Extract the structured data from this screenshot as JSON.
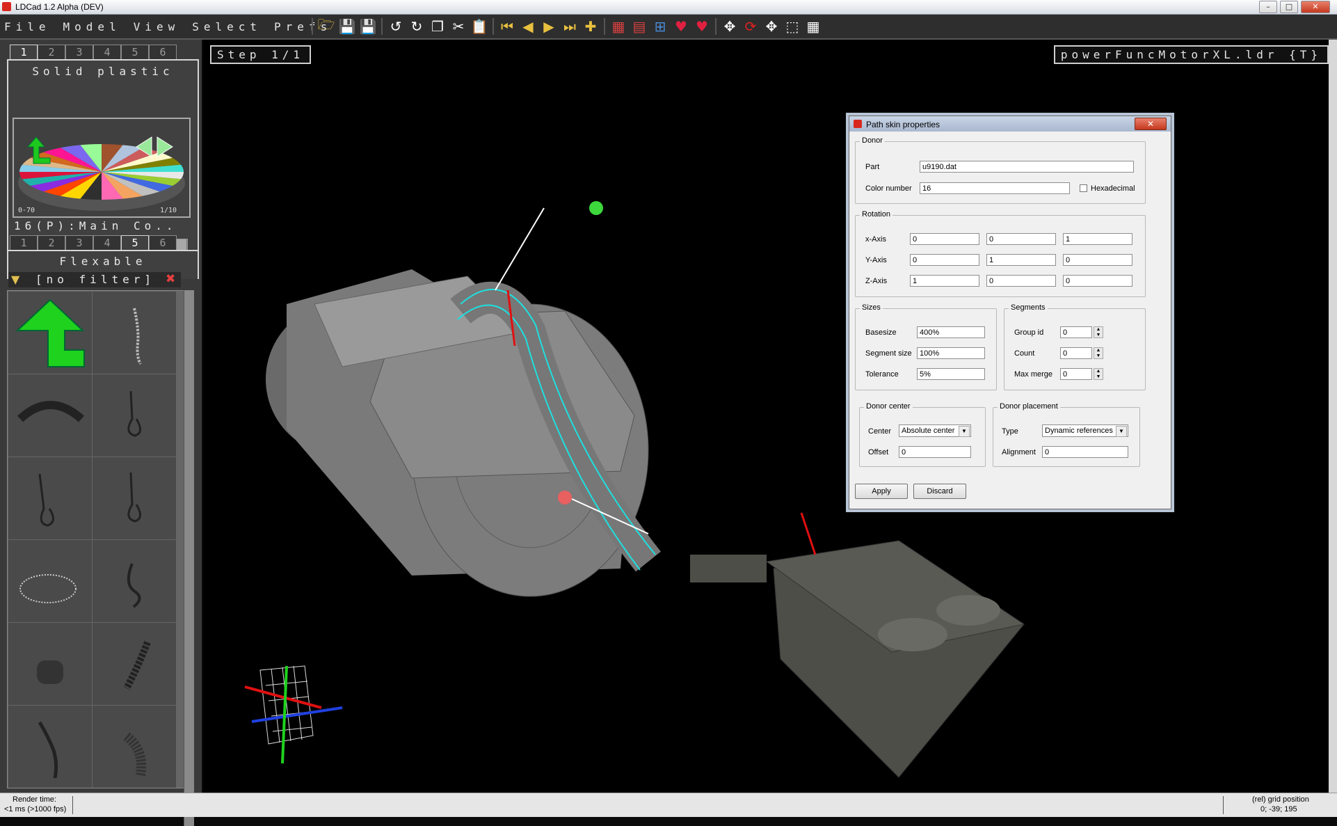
{
  "window": {
    "title": "LDCad 1.2 Alpha (DEV)",
    "min": "–",
    "max": "□",
    "close": "✕"
  },
  "menu": [
    "File",
    "Model",
    "View",
    "Select",
    "Prefs"
  ],
  "color_bin": {
    "tabs": [
      "1",
      "2",
      "3",
      "4",
      "5",
      "6"
    ],
    "active_tab": 0,
    "title": "Solid plastic",
    "range_left": "0-70",
    "range_right": "1/10",
    "current_color": "16(P):Main Co..",
    "swatches": [
      "#8a8a8a",
      "#8a8a8a",
      "#8a8a8a",
      "#8a8a8a",
      "#8a8a8a",
      "#8a8a8a",
      "#8a8a8a",
      "#b5b5b5",
      "#cc1a10",
      "#6a3a22",
      "#a8a8a8"
    ]
  },
  "part_bin": {
    "tabs": [
      "1",
      "2",
      "3",
      "4",
      "5",
      "6"
    ],
    "active_tab": 4,
    "title": "Flexable",
    "filter": "[no filter]"
  },
  "viewport": {
    "step_label": "Step 1/1",
    "model_label": "powerFuncMotorXL.ldr {T}"
  },
  "dialog": {
    "title": "Path skin properties",
    "donor": {
      "legend": "Donor",
      "part_label": "Part",
      "part_value": "u9190.dat",
      "color_label": "Color number",
      "color_value": "16",
      "hex_label": "Hexadecimal"
    },
    "rotation": {
      "legend": "Rotation",
      "rows": [
        {
          "label": "x-Axis",
          "v": [
            "0",
            "0",
            "1"
          ]
        },
        {
          "label": "Y-Axis",
          "v": [
            "0",
            "1",
            "0"
          ]
        },
        {
          "label": "Z-Axis",
          "v": [
            "1",
            "0",
            "0"
          ]
        }
      ]
    },
    "sizes": {
      "legend": "Sizes",
      "basesize_label": "Basesize",
      "basesize": "400%",
      "segsize_label": "Segment size",
      "segsize": "100%",
      "tolerance_label": "Tolerance",
      "tolerance": "5%"
    },
    "segments": {
      "legend": "Segments",
      "group_label": "Group id",
      "group": "0",
      "count_label": "Count",
      "count": "0",
      "merge_label": "Max merge",
      "merge": "0"
    },
    "center": {
      "legend": "Donor center",
      "center_label": "Center",
      "center_value": "Absolute center",
      "offset_label": "Offset",
      "offset_value": "0"
    },
    "placement": {
      "legend": "Donor placement",
      "type_label": "Type",
      "type_value": "Dynamic references",
      "align_label": "Alignment",
      "align_value": "0"
    },
    "apply": "Apply",
    "discard": "Discard"
  },
  "status": {
    "render_label": "Render time:",
    "render_value": "<1 ms (>1000 fps)",
    "grid_label": "(rel) grid position",
    "grid_value": "0; -39; 195"
  }
}
